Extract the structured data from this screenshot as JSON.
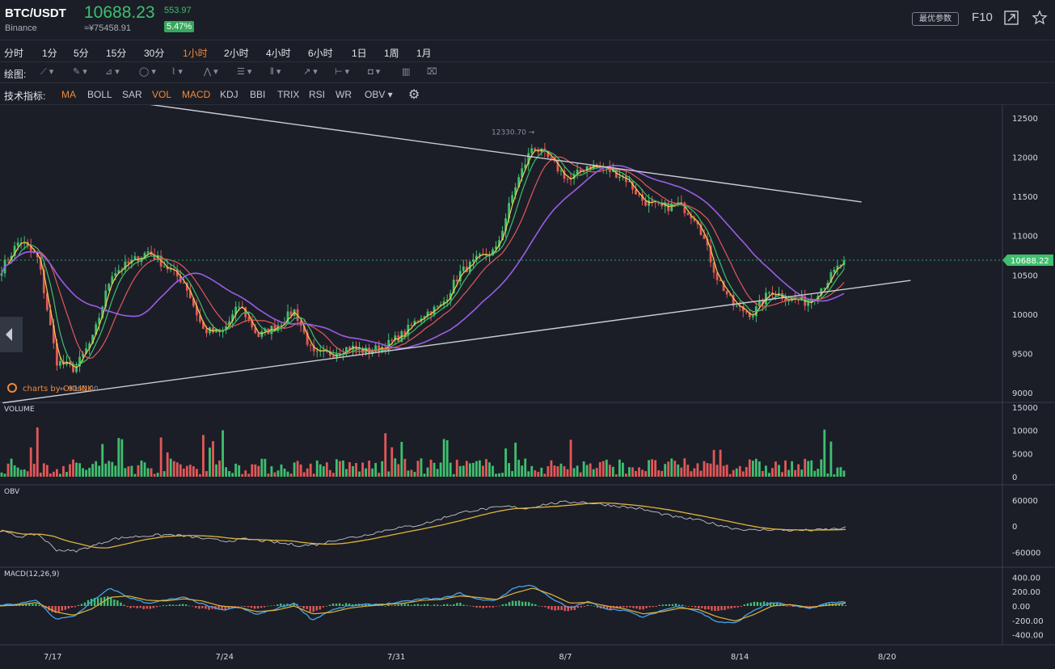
{
  "header": {
    "pair": "BTC/USDT",
    "exchange": "Binance",
    "price": "10688.23",
    "cny_price": "≈¥75458.91",
    "change": "553.97",
    "change_pct": "5.47%",
    "params_button": "最优参数",
    "f10": "F10",
    "icons": [
      "fullscreen-icon",
      "star-icon"
    ]
  },
  "periods": [
    "分时",
    "1分",
    "5分",
    "15分",
    "30分",
    "1小时",
    "2小时",
    "4小时",
    "6小时",
    "1日",
    "1周",
    "1月"
  ],
  "active_period": "1小时",
  "drawing": {
    "label": "绘图:",
    "tools": [
      "line-tool-icon",
      "pen-tool-icon",
      "channel-tool-icon",
      "shape-tool-icon",
      "wave-tool-icon",
      "pattern-tool-icon",
      "fibonacci-tool-icon",
      "gann-tool-icon",
      "arrow-tool-icon",
      "measure-tool-icon",
      "comment-tool-icon",
      "bar-pattern-icon",
      "trash-icon"
    ]
  },
  "indicators": {
    "label": "技术指标:",
    "items": [
      "MA",
      "BOLL",
      "SAR",
      "VOL",
      "MACD",
      "KDJ",
      "BBI",
      "TRIX",
      "RSI",
      "WR",
      "OBV"
    ],
    "active": [
      "MA",
      "VOL",
      "MACD"
    ],
    "settings_icon": "gear-icon"
  },
  "chart_data": {
    "type": "candlestick",
    "main": {
      "y_ticks": [
        "12500",
        "12000",
        "11500",
        "11000",
        "10500",
        "10000",
        "9500",
        "9000"
      ],
      "ylim": [
        9000,
        12500
      ],
      "high_label": "12330.70",
      "low_label": "9060.00",
      "current_price_label": "10688.22",
      "watermark": "charts by OKLINK",
      "closes": [
        10580,
        10950,
        10700,
        9400,
        9300,
        9700,
        10520,
        10650,
        10800,
        10600,
        10400,
        9800,
        9750,
        10120,
        9720,
        9850,
        10050,
        9480,
        9500,
        9580,
        9520,
        9600,
        9760,
        10000,
        10100,
        10520,
        10700,
        10820,
        11600,
        12150,
        11950,
        11700,
        11900,
        11850,
        11750,
        11450,
        11350,
        11400,
        11200,
        10500,
        10100,
        10000,
        10300,
        10200,
        10150,
        10400,
        10688
      ],
      "x_ticks": [
        "7/17",
        "7/24",
        "7/31",
        "8/7",
        "8/14",
        "8/20"
      ],
      "trendlines": [
        {
          "from": [
            "7/18",
            12800
          ],
          "to": [
            "8/19",
            11430
          ]
        },
        {
          "from": [
            "7/15",
            8870
          ],
          "to": [
            "8/21",
            10430
          ]
        }
      ]
    },
    "volume": {
      "label": "VOLUME",
      "y_ticks": [
        "15000",
        "10000",
        "5000",
        "0"
      ],
      "ylim": [
        0,
        15000
      ]
    },
    "obv": {
      "label": "OBV",
      "y_ticks": [
        "60000",
        "0",
        "-60000"
      ],
      "ylim": [
        -80000,
        80000
      ],
      "values": [
        -10000,
        -25000,
        -18000,
        -55000,
        -58000,
        -45000,
        -30000,
        -25000,
        -22000,
        -20000,
        -24000,
        -30000,
        -35000,
        -30000,
        -34000,
        -40000,
        -45000,
        -42000,
        -30000,
        -25000,
        -15000,
        -5000,
        0,
        10000,
        25000,
        35000,
        40000,
        45000,
        40000,
        50000,
        55000,
        55000,
        50000,
        45000,
        40000,
        30000,
        20000,
        15000,
        5000,
        -5000,
        -10000,
        -8000,
        -10000,
        -10000,
        -8000,
        -5000
      ]
    },
    "macd": {
      "label": "MACD(12,26,9)",
      "y_ticks": [
        "400.00",
        "200.00",
        "0.00",
        "-200.00",
        "-400.00"
      ],
      "ylim": [
        -450,
        450
      ],
      "dif": [
        10,
        30,
        80,
        -180,
        -150,
        60,
        250,
        120,
        40,
        80,
        120,
        30,
        -60,
        -20,
        -120,
        -40,
        40,
        -200,
        -60,
        0,
        20,
        30,
        60,
        100,
        100,
        180,
        90,
        80,
        260,
        290,
        100,
        -30,
        60,
        -40,
        -60,
        -160,
        -60,
        0,
        -80,
        -220,
        -240,
        -60,
        50,
        10,
        -40,
        40,
        60
      ],
      "dea": [
        0,
        15,
        50,
        -80,
        -130,
        -40,
        120,
        140,
        80,
        70,
        100,
        70,
        0,
        -20,
        -80,
        -60,
        0,
        -110,
        -90,
        -30,
        0,
        20,
        40,
        80,
        90,
        140,
        120,
        90,
        180,
        250,
        160,
        40,
        50,
        0,
        -40,
        -110,
        -80,
        -30,
        -50,
        -150,
        -210,
        -120,
        0,
        20,
        -20,
        10,
        40
      ]
    }
  }
}
